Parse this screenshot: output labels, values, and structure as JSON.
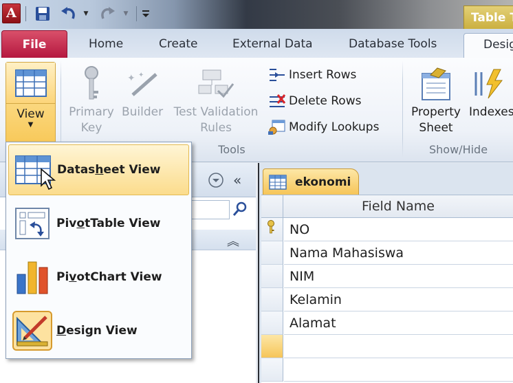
{
  "window": {
    "app_icon_letter": "A",
    "contextual_tab_title": "Table T"
  },
  "tabs": [
    {
      "label": "File"
    },
    {
      "label": "Home"
    },
    {
      "label": "Create"
    },
    {
      "label": "External Data"
    },
    {
      "label": "Database Tools"
    },
    {
      "label": "Desig"
    }
  ],
  "ribbon": {
    "view": {
      "label": "View"
    },
    "tools": {
      "primary_key": [
        "Primary",
        "Key"
      ],
      "builder": "Builder",
      "test_validation": [
        "Test Validation",
        "Rules"
      ],
      "insert_rows": "Insert Rows",
      "delete_rows": "Delete Rows",
      "modify_lookups": "Modify Lookups",
      "group_label": "Tools"
    },
    "show_hide": {
      "property_sheet": [
        "Property",
        "Sheet"
      ],
      "indexes": "Indexes",
      "group_label": "Show/Hide"
    }
  },
  "view_menu": {
    "items": [
      {
        "pre": "Datas",
        "underline": "h",
        "post": "eet View",
        "icon": "datasheet-view-icon",
        "highlighted": true
      },
      {
        "pre": "Piv",
        "underline": "o",
        "post": "tTable View",
        "icon": "pivottable-view-icon",
        "highlighted": false
      },
      {
        "pre": "Pi",
        "underline": "v",
        "post": "otChart View",
        "icon": "pivotchart-view-icon",
        "highlighted": false
      },
      {
        "pre": "",
        "underline": "D",
        "post": "esign View",
        "icon": "design-view-icon",
        "highlighted": false
      }
    ]
  },
  "nav_pane": {
    "menu_icon": "chevron-circle-down-icon",
    "collapse_icon": "double-chevron-left-icon",
    "search_icon": "search-icon",
    "group_toggle_icon": "double-chevron-up-icon"
  },
  "document": {
    "tab_label": "ekonomi",
    "column_header": "Field Name",
    "fields": [
      "NO",
      "Nama Mahasiswa",
      "NIM",
      "Kelamin",
      "Alamat"
    ]
  },
  "colors": {
    "file_tab": "#b5173f",
    "highlight": "#fbdc8d",
    "contextual": "#c9ad3b"
  }
}
